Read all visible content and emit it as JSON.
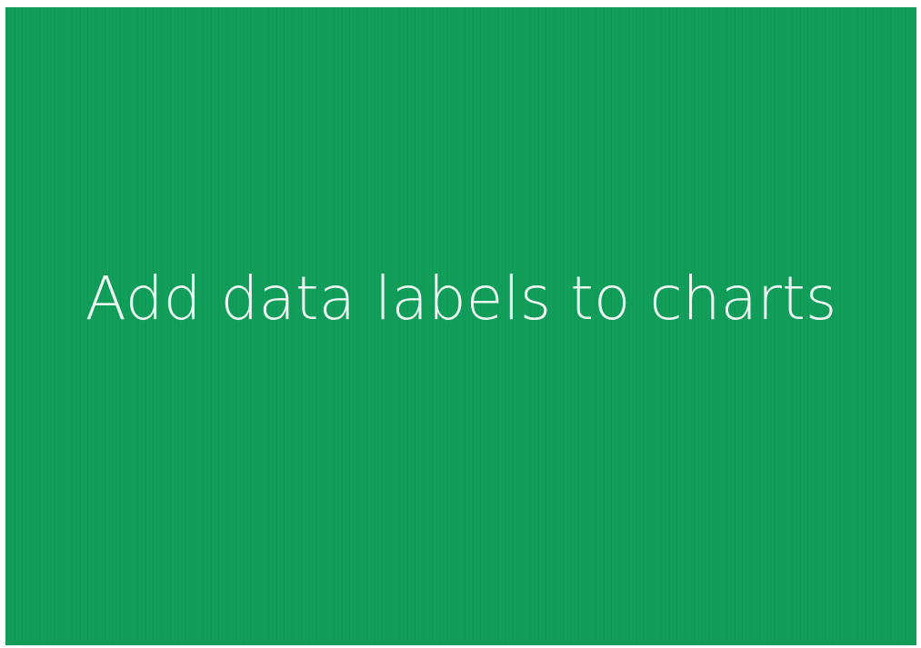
{
  "slide": {
    "title": "Add data labels to charts",
    "background_color": "#0f9d58",
    "text_color": "#ffffff"
  }
}
